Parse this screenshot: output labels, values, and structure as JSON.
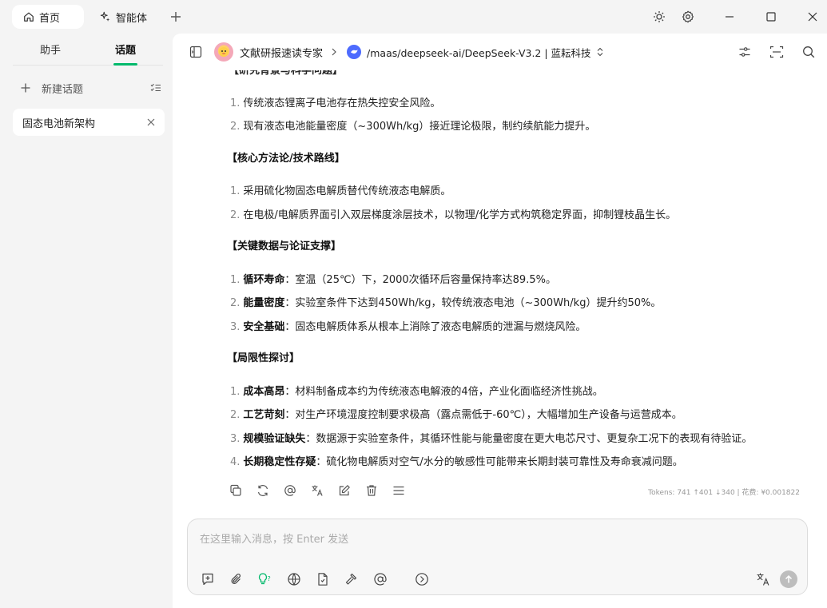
{
  "titlebar": {
    "home_tab": "首页",
    "agent_tab": "智能体"
  },
  "sidebar": {
    "tabs": [
      {
        "label": "助手",
        "active": false
      },
      {
        "label": "话题",
        "active": true
      }
    ],
    "new_topic": "新建话题",
    "topics": [
      {
        "label": "固态电池新架构",
        "active": true
      }
    ]
  },
  "header": {
    "assistant_name": "文献研报速读专家",
    "model_name": "/maas/deepseek-ai/DeepSeek-V3.2 | 蓝耘科技"
  },
  "message": {
    "cut_heading": "【研究背景与科学问题】",
    "background_items": [
      {
        "num": "1.",
        "text": "传统液态锂离子电池存在热失控安全风险。"
      },
      {
        "num": "2.",
        "text": "现有液态电池能量密度（~300Wh/kg）接近理论极限，制约续航能力提升。"
      }
    ],
    "sections": [
      {
        "title": "【核心方法论/技术路线】",
        "items": [
          {
            "num": "1.",
            "bold": "",
            "text": "采用硫化物固态电解质替代传统液态电解质。"
          },
          {
            "num": "2.",
            "bold": "",
            "text": "在电极/电解质界面引入双层梯度涂层技术，以物理/化学方式构筑稳定界面，抑制锂枝晶生长。"
          }
        ]
      },
      {
        "title": "【关键数据与论证支撑】",
        "items": [
          {
            "num": "1.",
            "bold": "循环寿命",
            "text": "：室温（25℃）下，2000次循环后容量保持率达89.5%。"
          },
          {
            "num": "2.",
            "bold": "能量密度",
            "text": "：实验室条件下达到450Wh/kg，较传统液态电池（~300Wh/kg）提升约50%。"
          },
          {
            "num": "3.",
            "bold": "安全基础",
            "text": "：固态电解质体系从根本上消除了液态电解质的泄漏与燃烧风险。"
          }
        ]
      },
      {
        "title": "【局限性探讨】",
        "items": [
          {
            "num": "1.",
            "bold": "成本高昂",
            "text": "：材料制备成本约为传统液态电解液的4倍，产业化面临经济性挑战。"
          },
          {
            "num": "2.",
            "bold": "工艺苛刻",
            "text": "：对生产环境湿度控制要求极高（露点需低于-60℃），大幅增加生产设备与运营成本。"
          },
          {
            "num": "3.",
            "bold": "规模验证缺失",
            "text": "：数据源于实验室条件，其循环性能与能量密度在更大电芯尺寸、更复杂工况下的表现有待验证。"
          },
          {
            "num": "4.",
            "bold": "长期稳定性存疑",
            "text": "：硫化物电解质对空气/水分的敏感性可能带来长期封装可靠性及寿命衰减问题。"
          }
        ]
      }
    ],
    "tokens": "Tokens: 741 ↑401 ↓340 | 花费: ¥0.001822"
  },
  "input": {
    "placeholder": "在这里输入消息，按 Enter 发送",
    "value": ""
  },
  "colors": {
    "accent": "#00b96b",
    "model_logo": "#4d6bfe",
    "send_disabled": "#bdbdbd"
  }
}
